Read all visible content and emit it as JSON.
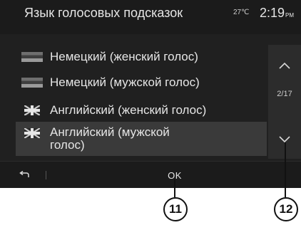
{
  "header": {
    "title": "Язык голосовых подсказок",
    "temperature": "27℃",
    "time": "2:19",
    "ampm": "PM"
  },
  "list": {
    "items": [
      {
        "flag": "flag-germany-icon",
        "label": "Немецкий (женский голос)"
      },
      {
        "flag": "flag-germany-icon",
        "label": "Немецкий (мужской голос)"
      },
      {
        "flag": "flag-uk-icon",
        "label": "Английский (женский голос)"
      },
      {
        "flag": "flag-uk-icon",
        "label": "Английский (мужской голос)",
        "selected": true
      }
    ]
  },
  "scroll": {
    "page_indicator": "2/17",
    "up_icon": "chevron-up-icon",
    "down_icon": "chevron-down-icon"
  },
  "footer": {
    "back_icon": "back-arrow-icon",
    "ok_label": "OK"
  },
  "callouts": {
    "ok": "11",
    "scroll": "12"
  }
}
